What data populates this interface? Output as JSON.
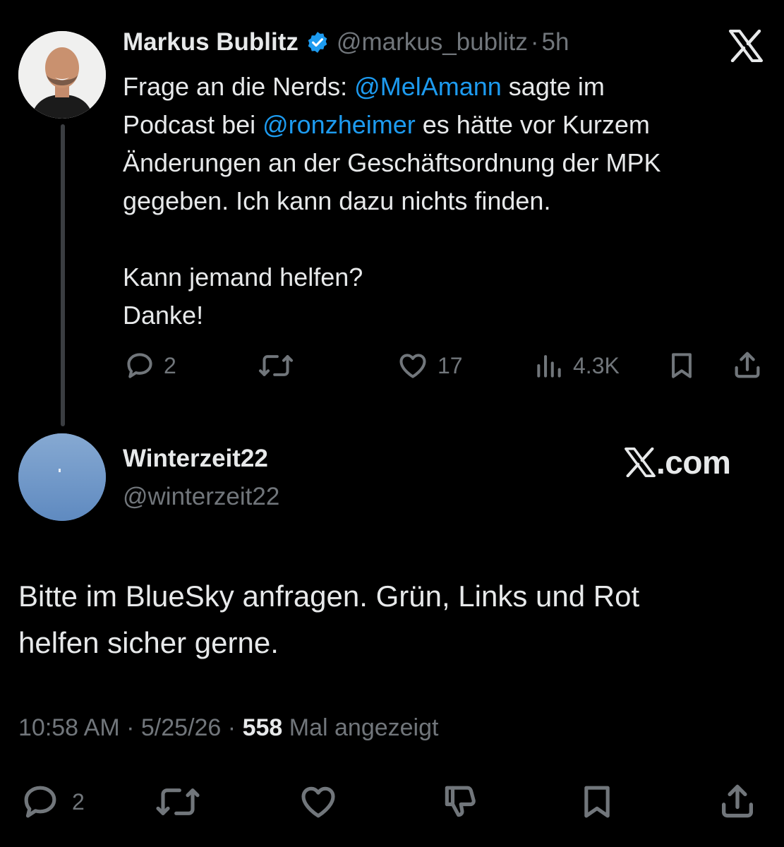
{
  "tweet": {
    "author_name": "Markus Bublitz",
    "author_handle": "@markus_bublitz",
    "separator": "·",
    "time_ago": "5h",
    "text_parts": {
      "p1": "Frage an die Nerds: ",
      "m1": "@MelAmann",
      "p2": " sagte im\nPodcast bei ",
      "m2": "@ronzheimer",
      "p3": " es hätte vor Kurzem\nÄnderungen an der Geschäftsordnung der MPK\ngegeben. Ich kann dazu nichts finden.\n\nKann jemand helfen?\nDanke!"
    },
    "replies": "2",
    "likes": "17",
    "views": "4.3K"
  },
  "reply": {
    "author_name": "Winterzeit22",
    "author_handle": "@winterzeit22",
    "text": "Bitte im BlueSky anfragen. Grün, Links und Rot\nhelfen sicher gerne.",
    "time": "10:58 AM",
    "date": "5/25/26",
    "separator": "·",
    "view_count": "558",
    "view_label": "Mal angezeigt",
    "replies": "2"
  },
  "watermark": {
    "text": ".com"
  },
  "icons": {
    "close": "x-logo-icon",
    "verified": "verified-badge-icon",
    "reply": "reply-icon",
    "retweet": "retweet-icon",
    "like": "heart-icon",
    "views": "views-icon",
    "bookmark": "bookmark-icon",
    "share": "share-icon",
    "dislike": "thumbs-down-icon"
  },
  "colors": {
    "background": "#000000",
    "text": "#e7e9ea",
    "muted": "#71767b",
    "link": "#1d9bf0",
    "verified": "#1d9bf0"
  }
}
